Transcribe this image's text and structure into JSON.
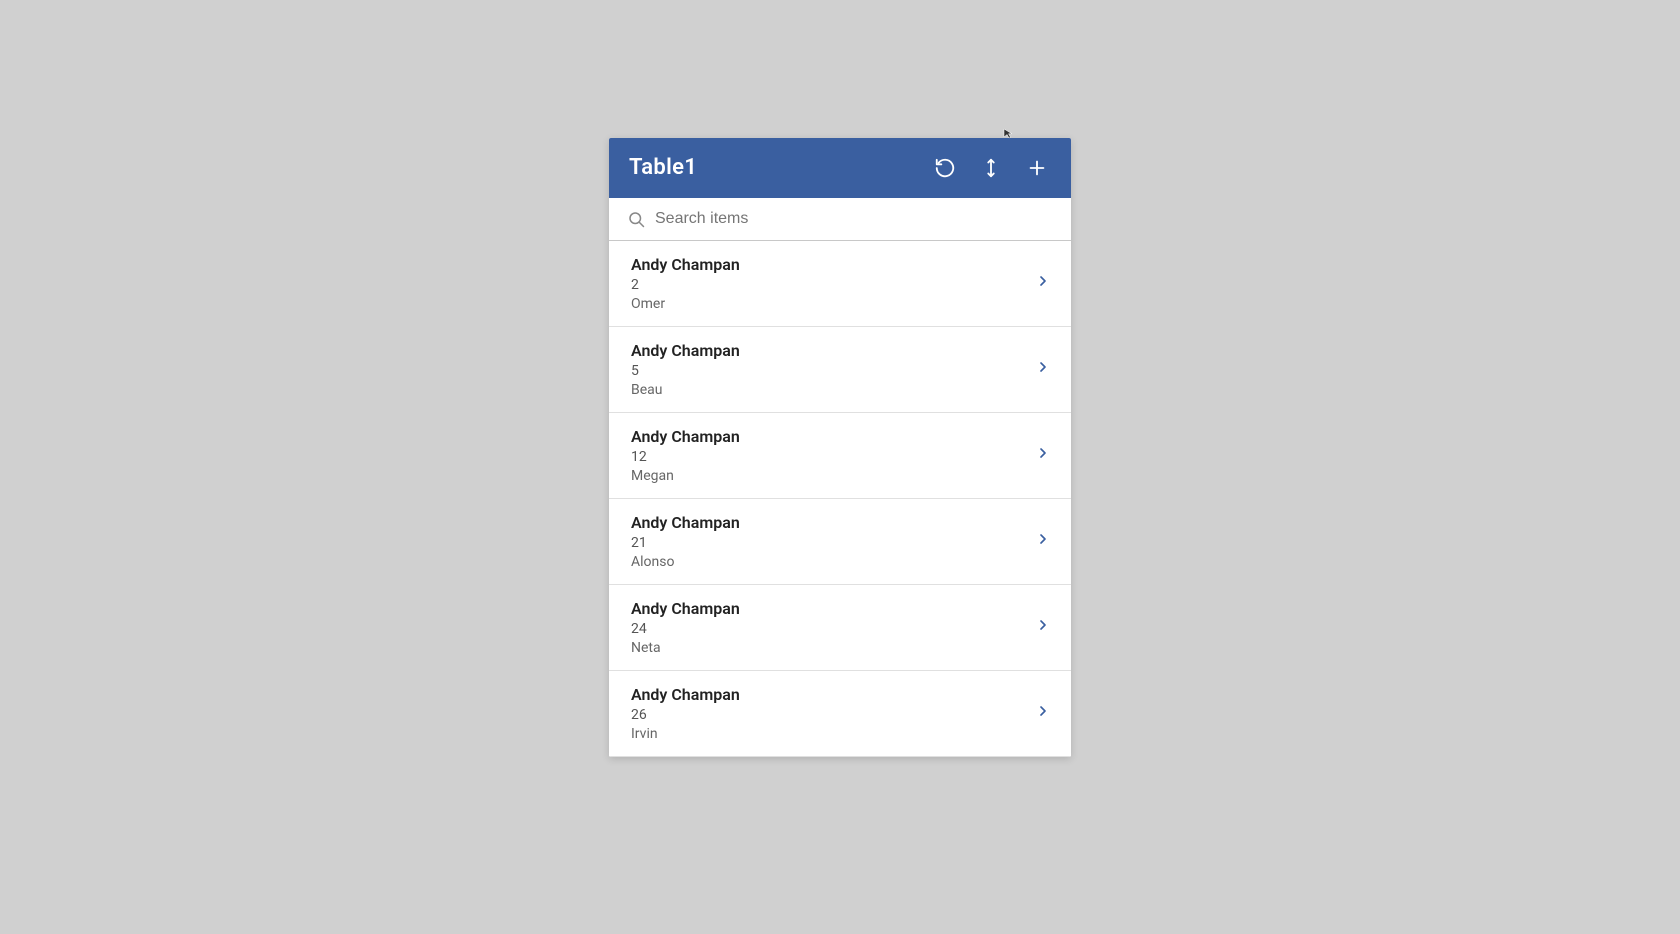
{
  "header": {
    "title": "Table1",
    "refresh_label": "refresh",
    "sort_label": "sort",
    "add_label": "add"
  },
  "search": {
    "placeholder": "Search items"
  },
  "items": [
    {
      "name": "Andy Champan",
      "number": "2",
      "sub": "Omer"
    },
    {
      "name": "Andy Champan",
      "number": "5",
      "sub": "Beau"
    },
    {
      "name": "Andy Champan",
      "number": "12",
      "sub": "Megan"
    },
    {
      "name": "Andy Champan",
      "number": "21",
      "sub": "Alonso"
    },
    {
      "name": "Andy Champan",
      "number": "24",
      "sub": "Neta"
    },
    {
      "name": "Andy Champan",
      "number": "26",
      "sub": "Irvin"
    }
  ],
  "colors": {
    "header_bg": "#3a5fa0",
    "chevron": "#3a5fa0"
  }
}
